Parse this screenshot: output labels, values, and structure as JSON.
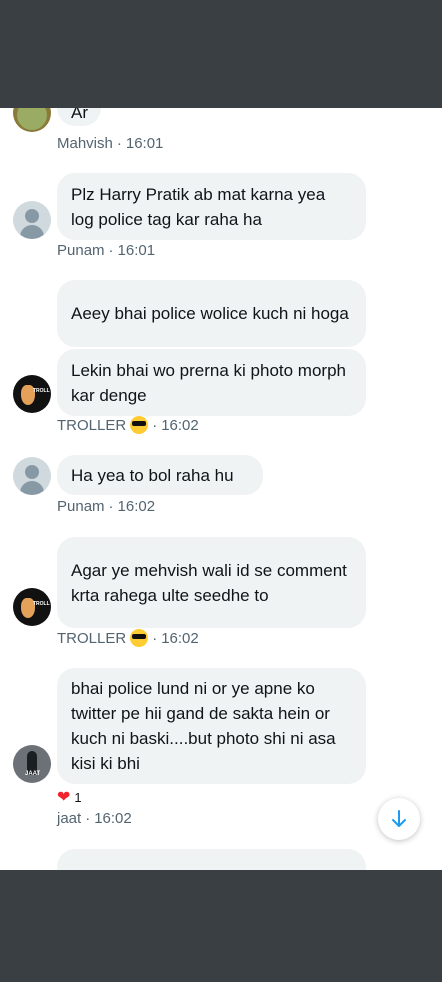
{
  "messages": [
    {
      "text": "Ar",
      "sender": "Mahvish",
      "time": "16:01"
    },
    {
      "text": "Plz Harry Pratik ab mat karna yea log police tag kar raha ha",
      "sender": "Punam",
      "time": "16:01"
    },
    {
      "text": "Aeey bhai police wolice kuch ni hoga"
    },
    {
      "text": "Lekin bhai wo prerna ki photo morph kar denge",
      "sender": "TROLLER",
      "time": "16:02"
    },
    {
      "text": "Ha yea to bol raha hu",
      "sender": "Punam",
      "time": "16:02"
    },
    {
      "text": "Agar ye mehvish wali id se comment krta rahega ulte seedhe to",
      "sender": "TROLLER",
      "time": "16:02"
    },
    {
      "text": "bhai police lund ni or ye apne ko twitter pe hii gand de sakta hein or kuch ni baski....but photo shi ni asa kisi ki bhi",
      "sender": "jaat",
      "time": "16:02",
      "reaction_count": "1"
    }
  ],
  "separator": "·",
  "avatar_labels": {
    "troller": "TROLL",
    "jaat": "JAAT"
  },
  "icons": {
    "reaction": "heart-icon",
    "scroll": "arrow-down-icon",
    "sender_badge": "sunglasses-emoji-icon"
  },
  "colors": {
    "bubble": "#eff3f4",
    "meta": "#536471",
    "accent": "#1d9bf0",
    "heart": "#f4212e"
  }
}
